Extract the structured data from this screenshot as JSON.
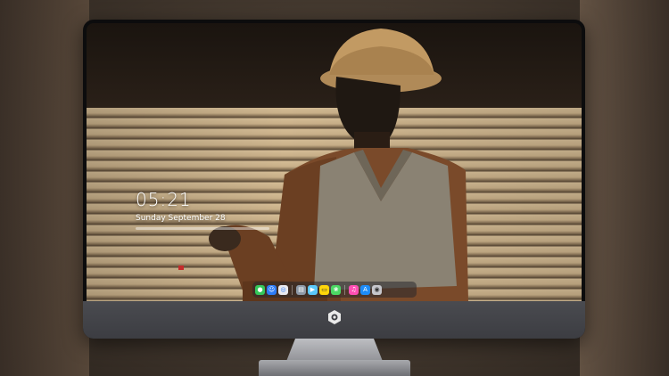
{
  "lock_screen": {
    "time": "05:21",
    "date": "Sunday September 28"
  },
  "dock": {
    "items": [
      {
        "name": "messages",
        "color": "#34c759",
        "glyph": "●"
      },
      {
        "name": "finder",
        "color": "#2d7cf6",
        "glyph": "☺"
      },
      {
        "name": "safari",
        "color": "#e9e9ee",
        "glyph": "◎"
      },
      {
        "name": "preview",
        "color": "#8e9aa8",
        "glyph": "▤"
      },
      {
        "name": "imovie",
        "color": "#5ac8fa",
        "glyph": "▶"
      },
      {
        "name": "notes",
        "color": "#ffd60a",
        "glyph": "▭"
      },
      {
        "name": "photos",
        "color": "#4cd964",
        "glyph": "❀"
      },
      {
        "name": "itunes",
        "color": "#ff4fb4",
        "glyph": "♫"
      },
      {
        "name": "app-store",
        "color": "#1d8cf8",
        "glyph": "A"
      },
      {
        "name": "camera",
        "color": "#c7c7cc",
        "glyph": "◉"
      }
    ]
  }
}
